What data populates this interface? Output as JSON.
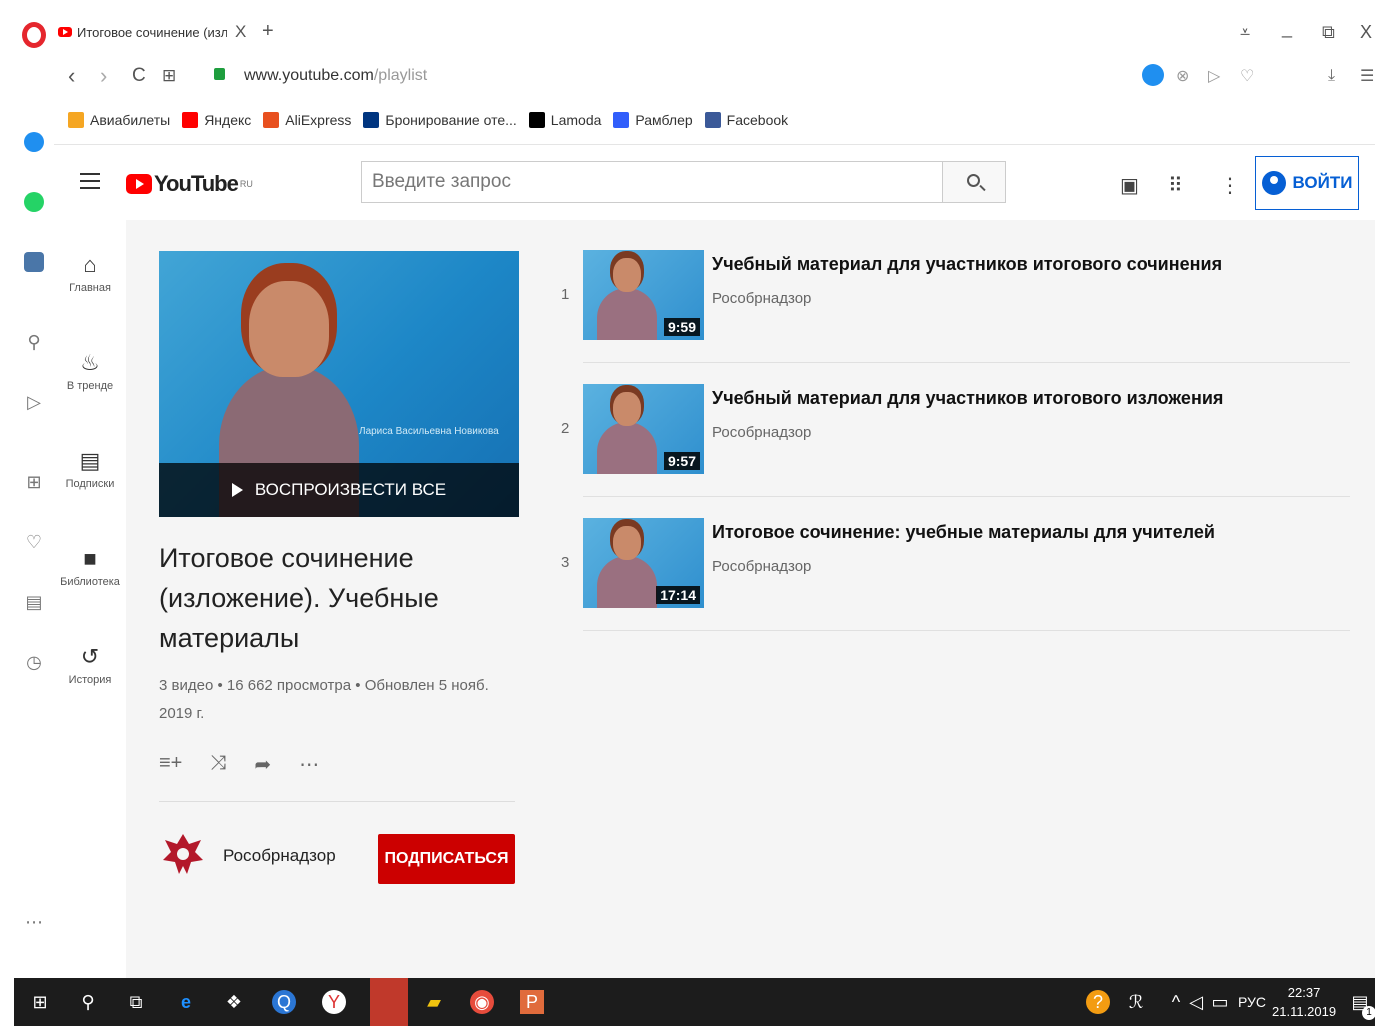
{
  "browser": {
    "tab_title": "Итоговое сочинение (изл",
    "tab_close": "X",
    "tab_new": "+",
    "url_host": "www.youtube.com",
    "url_path": "/playlist",
    "nav_back": "‹",
    "nav_forward": "›",
    "nav_reload": "C",
    "nav_tabs": "⊞",
    "win_minimize": "_",
    "win_restore": "⧉",
    "win_close": "X",
    "win_menu": "⩡"
  },
  "bookmarks": [
    {
      "label": "Авиабилеты",
      "icon": "plane-icon",
      "color": "#f5a623"
    },
    {
      "label": "Яндекс",
      "icon": "yandex-icon",
      "color": "#ff0000"
    },
    {
      "label": "AliExpress",
      "icon": "aliexpress-icon",
      "color": "#e8501f"
    },
    {
      "label": "Бронирование оте...",
      "icon": "booking-icon",
      "color": "#003580"
    },
    {
      "label": "Lamoda",
      "icon": "lamoda-icon",
      "color": "#000000"
    },
    {
      "label": "Рамблер",
      "icon": "rambler-icon",
      "color": "#315efb"
    },
    {
      "label": "Facebook",
      "icon": "facebook-icon",
      "color": "#3b5998"
    }
  ],
  "youtube": {
    "logo_word": "YouTube",
    "logo_region": "RU",
    "search_placeholder": "Введите запрос",
    "signin_label": "ВОЙТИ",
    "accent": "#ff0000",
    "link_color": "#065fd4"
  },
  "guide": [
    {
      "label": "Главная",
      "icon": "home-icon",
      "glyph": "⌂"
    },
    {
      "label": "В тренде",
      "icon": "trending-icon",
      "glyph": "♨"
    },
    {
      "label": "Подписки",
      "icon": "subscriptions-icon",
      "glyph": "▤"
    },
    {
      "label": "Библиотека",
      "icon": "library-icon",
      "glyph": "■"
    },
    {
      "label": "История",
      "icon": "history-icon",
      "glyph": "↺"
    }
  ],
  "playlist": {
    "play_all_label": "ВОСПРОИЗВЕСТИ ВСЕ",
    "thumb_caption": "Лариса Васильевна Новикова",
    "title": "Итоговое сочинение (изложение). Учебные материалы",
    "stats": "3 видео • 16 662 просмотра • Обновлен 5 нояб. 2019 г.",
    "channel_name": "Рособрнадзор",
    "subscribe_label": "ПОДПИСАТЬСЯ",
    "subscribe_color": "#cc0000"
  },
  "videos": [
    {
      "index": "1",
      "title": "Учебный материал для участников итогового сочинения",
      "channel": "Рособрнадзор",
      "duration": "9:59"
    },
    {
      "index": "2",
      "title": "Учебный материал для участников итогового изложения",
      "channel": "Рособрнадзор",
      "duration": "9:57"
    },
    {
      "index": "3",
      "title": "Итоговое сочинение: учебные материалы для учителей",
      "channel": "Рособрнадзор",
      "duration": "17:14"
    }
  ],
  "taskbar": {
    "lang": "РУС",
    "time": "22:37",
    "date": "21.11.2019",
    "notif_count": "1"
  }
}
